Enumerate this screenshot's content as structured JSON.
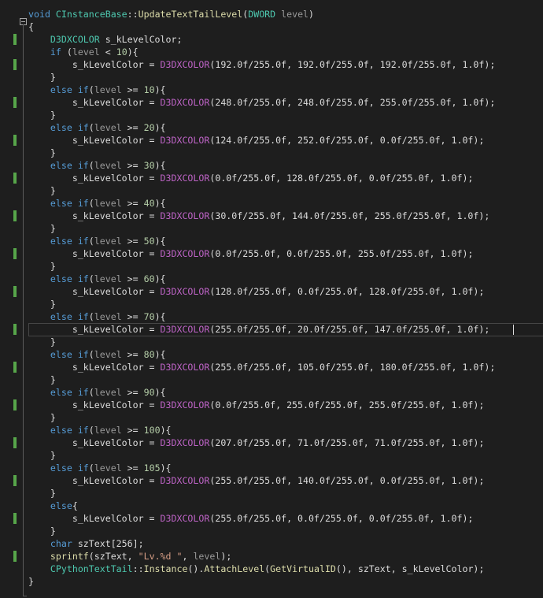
{
  "editor": {
    "lines": [
      {
        "tokens": [
          {
            "c": "kw",
            "t": "void"
          },
          {
            "c": "pl",
            "t": " "
          },
          {
            "c": "ty",
            "t": "CInstanceBase"
          },
          {
            "c": "pl",
            "t": "::"
          },
          {
            "c": "fn",
            "t": "UpdateTextTailLevel"
          },
          {
            "c": "pl",
            "t": "("
          },
          {
            "c": "ty",
            "t": "DWORD"
          },
          {
            "c": "pl",
            "t": " "
          },
          {
            "c": "pm",
            "t": "level"
          },
          {
            "c": "pl",
            "t": ")"
          }
        ]
      },
      {
        "tokens": [
          {
            "c": "pl",
            "t": "{"
          }
        ]
      },
      {
        "changed": true,
        "tokens": [
          {
            "c": "pl",
            "t": "    "
          },
          {
            "c": "ty",
            "t": "D3DXCOLOR"
          },
          {
            "c": "pl",
            "t": " s_kLevelColor;"
          }
        ]
      },
      {
        "tokens": [
          {
            "c": "pl",
            "t": "    "
          },
          {
            "c": "kw",
            "t": "if"
          },
          {
            "c": "pl",
            "t": " ("
          },
          {
            "c": "pm",
            "t": "level"
          },
          {
            "c": "pl",
            "t": " < "
          },
          {
            "c": "num",
            "t": "10"
          },
          {
            "c": "pl",
            "t": "){"
          }
        ]
      },
      {
        "changed": true,
        "tokens": [
          {
            "c": "pl",
            "t": "        s_kLevelColor = "
          },
          {
            "c": "mac",
            "t": "D3DXCOLOR"
          },
          {
            "c": "pl",
            "t": "(192.0f/255.0f, 192.0f/255.0f, 192.0f/255.0f, 1.0f);"
          }
        ]
      },
      {
        "tokens": [
          {
            "c": "pl",
            "t": "    }"
          }
        ]
      },
      {
        "tokens": [
          {
            "c": "pl",
            "t": "    "
          },
          {
            "c": "kw",
            "t": "else if"
          },
          {
            "c": "pl",
            "t": "("
          },
          {
            "c": "pm",
            "t": "level"
          },
          {
            "c": "pl",
            "t": " >= "
          },
          {
            "c": "num",
            "t": "10"
          },
          {
            "c": "pl",
            "t": "){"
          }
        ]
      },
      {
        "changed": true,
        "tokens": [
          {
            "c": "pl",
            "t": "        s_kLevelColor = "
          },
          {
            "c": "mac",
            "t": "D3DXCOLOR"
          },
          {
            "c": "pl",
            "t": "(248.0f/255.0f, 248.0f/255.0f, 255.0f/255.0f, 1.0f);"
          }
        ]
      },
      {
        "tokens": [
          {
            "c": "pl",
            "t": "    }"
          }
        ]
      },
      {
        "tokens": [
          {
            "c": "pl",
            "t": "    "
          },
          {
            "c": "kw",
            "t": "else if"
          },
          {
            "c": "pl",
            "t": "("
          },
          {
            "c": "pm",
            "t": "level"
          },
          {
            "c": "pl",
            "t": " >= "
          },
          {
            "c": "num",
            "t": "20"
          },
          {
            "c": "pl",
            "t": "){"
          }
        ]
      },
      {
        "changed": true,
        "tokens": [
          {
            "c": "pl",
            "t": "        s_kLevelColor = "
          },
          {
            "c": "mac",
            "t": "D3DXCOLOR"
          },
          {
            "c": "pl",
            "t": "(124.0f/255.0f, 252.0f/255.0f, 0.0f/255.0f, 1.0f);"
          }
        ]
      },
      {
        "tokens": [
          {
            "c": "pl",
            "t": "    }"
          }
        ]
      },
      {
        "tokens": [
          {
            "c": "pl",
            "t": "    "
          },
          {
            "c": "kw",
            "t": "else if"
          },
          {
            "c": "pl",
            "t": "("
          },
          {
            "c": "pm",
            "t": "level"
          },
          {
            "c": "pl",
            "t": " >= "
          },
          {
            "c": "num",
            "t": "30"
          },
          {
            "c": "pl",
            "t": "){"
          }
        ]
      },
      {
        "changed": true,
        "tokens": [
          {
            "c": "pl",
            "t": "        s_kLevelColor = "
          },
          {
            "c": "mac",
            "t": "D3DXCOLOR"
          },
          {
            "c": "pl",
            "t": "(0.0f/255.0f, 128.0f/255.0f, 0.0f/255.0f, 1.0f);"
          }
        ]
      },
      {
        "tokens": [
          {
            "c": "pl",
            "t": "    }"
          }
        ]
      },
      {
        "tokens": [
          {
            "c": "pl",
            "t": "    "
          },
          {
            "c": "kw",
            "t": "else if"
          },
          {
            "c": "pl",
            "t": "("
          },
          {
            "c": "pm",
            "t": "level"
          },
          {
            "c": "pl",
            "t": " >= "
          },
          {
            "c": "num",
            "t": "40"
          },
          {
            "c": "pl",
            "t": "){"
          }
        ]
      },
      {
        "changed": true,
        "tokens": [
          {
            "c": "pl",
            "t": "        s_kLevelColor = "
          },
          {
            "c": "mac",
            "t": "D3DXCOLOR"
          },
          {
            "c": "pl",
            "t": "(30.0f/255.0f, 144.0f/255.0f, 255.0f/255.0f, 1.0f);"
          }
        ]
      },
      {
        "tokens": [
          {
            "c": "pl",
            "t": "    }"
          }
        ]
      },
      {
        "tokens": [
          {
            "c": "pl",
            "t": "    "
          },
          {
            "c": "kw",
            "t": "else if"
          },
          {
            "c": "pl",
            "t": "("
          },
          {
            "c": "pm",
            "t": "level"
          },
          {
            "c": "pl",
            "t": " >= "
          },
          {
            "c": "num",
            "t": "50"
          },
          {
            "c": "pl",
            "t": "){"
          }
        ]
      },
      {
        "changed": true,
        "tokens": [
          {
            "c": "pl",
            "t": "        s_kLevelColor = "
          },
          {
            "c": "mac",
            "t": "D3DXCOLOR"
          },
          {
            "c": "pl",
            "t": "(0.0f/255.0f, 0.0f/255.0f, 255.0f/255.0f, 1.0f);"
          }
        ]
      },
      {
        "tokens": [
          {
            "c": "pl",
            "t": "    }"
          }
        ]
      },
      {
        "tokens": [
          {
            "c": "pl",
            "t": "    "
          },
          {
            "c": "kw",
            "t": "else if"
          },
          {
            "c": "pl",
            "t": "("
          },
          {
            "c": "pm",
            "t": "level"
          },
          {
            "c": "pl",
            "t": " >= "
          },
          {
            "c": "num",
            "t": "60"
          },
          {
            "c": "pl",
            "t": "){"
          }
        ]
      },
      {
        "changed": true,
        "tokens": [
          {
            "c": "pl",
            "t": "        s_kLevelColor = "
          },
          {
            "c": "mac",
            "t": "D3DXCOLOR"
          },
          {
            "c": "pl",
            "t": "(128.0f/255.0f, 0.0f/255.0f, 128.0f/255.0f, 1.0f);"
          }
        ]
      },
      {
        "tokens": [
          {
            "c": "pl",
            "t": "    }"
          }
        ]
      },
      {
        "tokens": [
          {
            "c": "pl",
            "t": "    "
          },
          {
            "c": "kw",
            "t": "else if"
          },
          {
            "c": "pl",
            "t": "("
          },
          {
            "c": "pm",
            "t": "level"
          },
          {
            "c": "pl",
            "t": " >= "
          },
          {
            "c": "num",
            "t": "70"
          },
          {
            "c": "pl",
            "t": "){"
          }
        ]
      },
      {
        "changed": true,
        "current": true,
        "tokens": [
          {
            "c": "pl",
            "t": "        s_kLevelColor = "
          },
          {
            "c": "mac",
            "t": "D3DXCOLOR"
          },
          {
            "c": "pl",
            "t": "(255.0f/255.0f, 20.0f/255.0f, 147.0f/255.0f, 1.0f);"
          }
        ]
      },
      {
        "tokens": [
          {
            "c": "pl",
            "t": "    }"
          }
        ]
      },
      {
        "tokens": [
          {
            "c": "pl",
            "t": "    "
          },
          {
            "c": "kw",
            "t": "else if"
          },
          {
            "c": "pl",
            "t": "("
          },
          {
            "c": "pm",
            "t": "level"
          },
          {
            "c": "pl",
            "t": " >= "
          },
          {
            "c": "num",
            "t": "80"
          },
          {
            "c": "pl",
            "t": "){"
          }
        ]
      },
      {
        "changed": true,
        "tokens": [
          {
            "c": "pl",
            "t": "        s_kLevelColor = "
          },
          {
            "c": "mac",
            "t": "D3DXCOLOR"
          },
          {
            "c": "pl",
            "t": "(255.0f/255.0f, 105.0f/255.0f, 180.0f/255.0f, 1.0f);"
          }
        ]
      },
      {
        "tokens": [
          {
            "c": "pl",
            "t": "    }"
          }
        ]
      },
      {
        "tokens": [
          {
            "c": "pl",
            "t": "    "
          },
          {
            "c": "kw",
            "t": "else if"
          },
          {
            "c": "pl",
            "t": "("
          },
          {
            "c": "pm",
            "t": "level"
          },
          {
            "c": "pl",
            "t": " >= "
          },
          {
            "c": "num",
            "t": "90"
          },
          {
            "c": "pl",
            "t": "){"
          }
        ]
      },
      {
        "changed": true,
        "tokens": [
          {
            "c": "pl",
            "t": "        s_kLevelColor = "
          },
          {
            "c": "mac",
            "t": "D3DXCOLOR"
          },
          {
            "c": "pl",
            "t": "(0.0f/255.0f, 255.0f/255.0f, 255.0f/255.0f, 1.0f);"
          }
        ]
      },
      {
        "tokens": [
          {
            "c": "pl",
            "t": "    }"
          }
        ]
      },
      {
        "tokens": [
          {
            "c": "pl",
            "t": "    "
          },
          {
            "c": "kw",
            "t": "else if"
          },
          {
            "c": "pl",
            "t": "("
          },
          {
            "c": "pm",
            "t": "level"
          },
          {
            "c": "pl",
            "t": " >= "
          },
          {
            "c": "num",
            "t": "100"
          },
          {
            "c": "pl",
            "t": "){"
          }
        ]
      },
      {
        "changed": true,
        "tokens": [
          {
            "c": "pl",
            "t": "        s_kLevelColor = "
          },
          {
            "c": "mac",
            "t": "D3DXCOLOR"
          },
          {
            "c": "pl",
            "t": "(207.0f/255.0f, 71.0f/255.0f, 71.0f/255.0f, 1.0f);"
          }
        ]
      },
      {
        "tokens": [
          {
            "c": "pl",
            "t": "    }"
          }
        ]
      },
      {
        "tokens": [
          {
            "c": "pl",
            "t": "    "
          },
          {
            "c": "kw",
            "t": "else if"
          },
          {
            "c": "pl",
            "t": "("
          },
          {
            "c": "pm",
            "t": "level"
          },
          {
            "c": "pl",
            "t": " >= "
          },
          {
            "c": "num",
            "t": "105"
          },
          {
            "c": "pl",
            "t": "){"
          }
        ]
      },
      {
        "changed": true,
        "tokens": [
          {
            "c": "pl",
            "t": "        s_kLevelColor = "
          },
          {
            "c": "mac",
            "t": "D3DXCOLOR"
          },
          {
            "c": "pl",
            "t": "(255.0f/255.0f, 140.0f/255.0f, 0.0f/255.0f, 1.0f);"
          }
        ]
      },
      {
        "tokens": [
          {
            "c": "pl",
            "t": "    }"
          }
        ]
      },
      {
        "tokens": [
          {
            "c": "pl",
            "t": "    "
          },
          {
            "c": "kw",
            "t": "else"
          },
          {
            "c": "pl",
            "t": "{"
          }
        ]
      },
      {
        "changed": true,
        "tokens": [
          {
            "c": "pl",
            "t": "        s_kLevelColor = "
          },
          {
            "c": "mac",
            "t": "D3DXCOLOR"
          },
          {
            "c": "pl",
            "t": "(255.0f/255.0f, 0.0f/255.0f, 0.0f/255.0f, 1.0f);"
          }
        ]
      },
      {
        "tokens": [
          {
            "c": "pl",
            "t": "    }"
          }
        ]
      },
      {
        "tokens": [
          {
            "c": "pl",
            "t": "    "
          },
          {
            "c": "kw",
            "t": "char"
          },
          {
            "c": "pl",
            "t": " szText[256];"
          }
        ]
      },
      {
        "changed": true,
        "tokens": [
          {
            "c": "pl",
            "t": "    "
          },
          {
            "c": "fn",
            "t": "sprintf"
          },
          {
            "c": "pl",
            "t": "(szText, "
          },
          {
            "c": "str",
            "t": "\"Lv.%d \""
          },
          {
            "c": "pl",
            "t": ", "
          },
          {
            "c": "pm",
            "t": "level"
          },
          {
            "c": "pl",
            "t": ");"
          }
        ]
      },
      {
        "tokens": [
          {
            "c": "pl",
            "t": "    "
          },
          {
            "c": "ty",
            "t": "CPythonTextTail"
          },
          {
            "c": "pl",
            "t": "::"
          },
          {
            "c": "fn",
            "t": "Instance"
          },
          {
            "c": "pl",
            "t": "()."
          },
          {
            "c": "fn",
            "t": "AttachLevel"
          },
          {
            "c": "pl",
            "t": "("
          },
          {
            "c": "fn",
            "t": "GetVirtualID"
          },
          {
            "c": "pl",
            "t": "(), szText, s_kLevelColor);"
          }
        ]
      },
      {
        "tokens": [
          {
            "c": "pl",
            "t": "}"
          }
        ]
      }
    ]
  },
  "colors": {
    "background": "#1e1e1e",
    "change_bar": "#57a64a",
    "keyword": "#569cd6",
    "type": "#4ec9b0",
    "macro": "#bd63c5",
    "function": "#dcdcaa",
    "parameter": "#9a9a9a",
    "string": "#d69d85"
  }
}
